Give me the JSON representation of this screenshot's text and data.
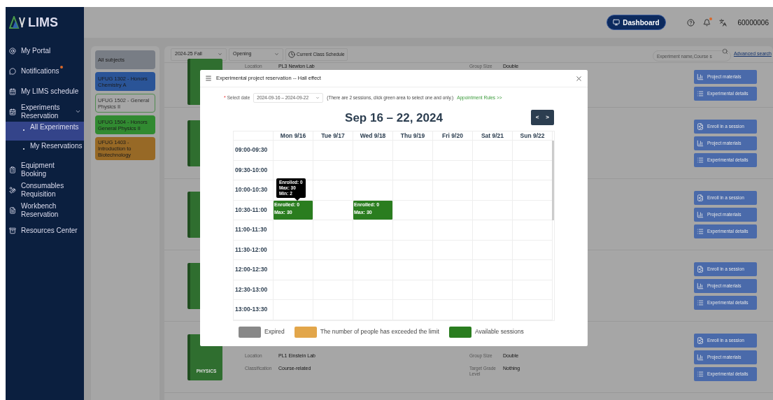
{
  "sidebar": {
    "logo_text": "LIMS",
    "items": [
      {
        "label": "My Portal",
        "selected": false,
        "badge": false
      },
      {
        "label": "Notifications",
        "selected": false,
        "badge": true
      },
      {
        "label": "My LIMS schedule",
        "selected": false,
        "badge": false
      },
      {
        "label": "Experiments Reservation",
        "selected": false,
        "badge": false,
        "expanded": true,
        "children": [
          {
            "label": "All Experiments",
            "selected": true
          },
          {
            "label": "My Reservations",
            "selected": false
          }
        ]
      },
      {
        "label": "Equipment Booking",
        "selected": false,
        "badge": false
      },
      {
        "label": "Consumables Requisition",
        "selected": false,
        "badge": false
      },
      {
        "label": "Workbench Reservation",
        "selected": false,
        "badge": false
      },
      {
        "label": "Resources Center",
        "selected": false,
        "badge": false
      }
    ]
  },
  "header": {
    "dashboard_button": "Dashboard",
    "notification_dot": true,
    "user": "60000006"
  },
  "subjects": [
    {
      "label": "All subjects",
      "color": "#787d85",
      "selected": false
    },
    {
      "label": "UFUG 1302 - Honors Chemistry A",
      "color": "#2a5497",
      "selected": false
    },
    {
      "label": "UFUG 1502 - General Physics II",
      "color": "#a6a6a6",
      "selected": true
    },
    {
      "label": "UFUG 1504 - Honors General Physics II",
      "color": "#318a31",
      "selected": false
    },
    {
      "label": "UFUG 1403 - Introduction to Biotechnology",
      "color": "#976926",
      "selected": false
    }
  ],
  "toolbar": {
    "term": "2024-25 Fall",
    "status": "Opening",
    "schedule_button": "Current Class Schedule",
    "search_placeholder": "Experiment name,Course s",
    "advanced_link": "Advanced search"
  },
  "cards": [
    {
      "fields": [
        {
          "label": "Location",
          "value": "PL3 Newton Lab"
        },
        {
          "label": "Group Size",
          "value": "Double"
        }
      ],
      "buttons": [
        {
          "kind": "materials",
          "label": "Project materials"
        },
        {
          "kind": "details",
          "label": "Experimental details"
        }
      ]
    },
    {
      "buttons": [
        {
          "kind": "enroll",
          "label": "Enroll in a session"
        },
        {
          "kind": "materials",
          "label": "Project materials"
        },
        {
          "kind": "details",
          "label": "Experimental details"
        }
      ]
    },
    {
      "buttons": [
        {
          "kind": "enroll",
          "label": "Enroll in a session"
        },
        {
          "kind": "materials",
          "label": "Project materials"
        },
        {
          "kind": "details",
          "label": "Experimental details"
        }
      ]
    },
    {
      "buttons": [
        {
          "kind": "enroll",
          "label": "Enroll in a session"
        },
        {
          "kind": "materials",
          "label": "Project materials"
        },
        {
          "kind": "details",
          "label": "Experimental details"
        }
      ]
    },
    {
      "book_label": "PHYSICS",
      "fields": [
        {
          "label": "Location",
          "value": "PL1 Einstein Lab"
        },
        {
          "label": "Group Size",
          "value": "Double"
        },
        {
          "label": "Classification",
          "value": "Course-related"
        },
        {
          "label": "Target Grade Level",
          "value": "Nothing"
        }
      ],
      "buttons": [
        {
          "kind": "enroll",
          "label": "Enroll in a session"
        },
        {
          "kind": "materials",
          "label": "Project materials"
        },
        {
          "kind": "details",
          "label": "Experimental details"
        }
      ]
    }
  ],
  "modal": {
    "title": "Experimental project reservation -- Hall effect",
    "required_mark": "*",
    "date_label": "Select date",
    "date_value": "2024-09-16 – 2024-09-22",
    "hint": "(There are 2 sessions, click green area to select one and only.)",
    "rules_link": "Appointment Rules >>",
    "heading": "Sep 16 – 22, 2024",
    "nav": [
      "<",
      ">"
    ],
    "days": [
      "Mon 9/16",
      "Tue 9/17",
      "Wed 9/18",
      "Thu 9/19",
      "Fri 9/20",
      "Sat 9/21",
      "Sun 9/22"
    ],
    "rows": [
      {
        "time": "09:00-09:30"
      },
      {
        "time": "09:30-10:00"
      },
      {
        "time": "10:00-10:30"
      },
      {
        "time": "10:30-11:00",
        "cells": [
          {
            "kind": "available",
            "lines": [
              "Enrolled: 0",
              "Max: 30"
            ],
            "tooltip": [
              "Enrolled: 0",
              "Max: 30",
              "Min: 2"
            ]
          },
          {
            "kind": "none"
          },
          {
            "kind": "available",
            "lines": [
              "Enrolled: 0",
              "Max: 30"
            ]
          },
          {
            "kind": "none"
          },
          {
            "kind": "none"
          },
          {
            "kind": "none"
          },
          {
            "kind": "none"
          }
        ]
      },
      {
        "time": "11:00-11:30"
      },
      {
        "time": "11:30-12:00"
      },
      {
        "time": "12:00-12:30"
      },
      {
        "time": "12:30-13:00"
      },
      {
        "time": "13:00-13:30"
      }
    ],
    "legend": [
      {
        "label": "Expired",
        "color": "#888888"
      },
      {
        "label": "The number of people has exceeded the limit",
        "color": "#e2a64a"
      },
      {
        "label": "Available sessions",
        "color": "#2a7d1f"
      }
    ]
  }
}
